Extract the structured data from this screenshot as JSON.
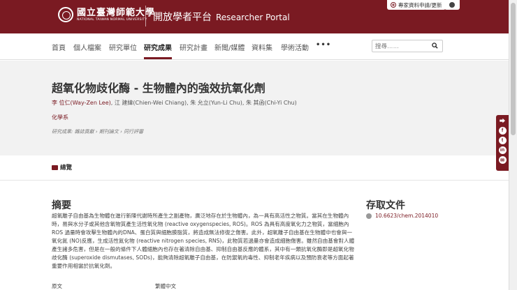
{
  "header": {
    "logo_zh": "國立臺灣師範大學",
    "logo_en": "NATIONAL TAIWAN NORMAL UNIVERSITY",
    "portal_zh": "開放學者平台",
    "portal_en": "Researcher Portal",
    "update_label": "專家資料申請/更新",
    "brand_color": "#7a1a22"
  },
  "nav": {
    "items": [
      {
        "label": "首頁"
      },
      {
        "label": "個人檔案"
      },
      {
        "label": "研究單位"
      },
      {
        "label": "研究成果"
      },
      {
        "label": "研究計畫"
      },
      {
        "label": "新聞/媒體"
      },
      {
        "label": "資料集"
      },
      {
        "label": "學術活動"
      }
    ],
    "active": "研究成果",
    "more": "•••",
    "search_placeholder": "搜尋……"
  },
  "publication": {
    "title": "超氧化物歧化酶 - 生物體內的強效抗氧化劑",
    "lead_author": "李 位仁(Way-Zen Lee)",
    "other_authors": ", 江 建緯(Chien-Wei Chiang), 朱 允立(Yun-Li Chu), 朱 其函(Chi-Yi Chu)",
    "department": "化學系",
    "output_type": "研究成果: 雜誌貢獻 › 期刊論文 › 同行評審"
  },
  "tabs": {
    "overview": "總覽"
  },
  "abstract": {
    "heading": "摘要",
    "body": "超氧離子自由基為生物體在進行新陳代謝時所產生之副產物，廣泛地存在於生物體內，為一具有高活性之物質。當其在生物體內時，易與水分子或其他含氧物質產生活性氧化物 (reactive oxygenspecies, ROS)。ROS 為具有高度氧化力之物質，當細胞內ROS 過量時會攻擊生物體內的DNA、蛋白質與細胞膜脂質，將造成無法修復之傷害。此外，超氧離子自由基在生物體中也會與一氧化氮 (NO)反應，生成活性氮化物 (reactive nitrogen species, RNS)，此物質若過量亦會造成細胞傷害。雖然自由基會對人體產生諸多危害，但是在一般的條件下人體細胞內也存在著清除自由基、抑制自由基反應的體系，其中有一類抗氧化酶即是超氧化物歧化酶 (superoxide dismutases, SODs)，能夠清除超氧離子自由基，在防禦氧的毒性、抑制老年疾病以及預防衰老等方面起著重要作用相當於抗氧化劑。"
  },
  "metadata": {
    "language_label": "原文",
    "language_value": "繁體中文"
  },
  "access": {
    "heading": "存取文件",
    "doi": "10.6623/chem.2014010"
  },
  "share": {
    "icons": [
      "share-icon",
      "facebook-icon",
      "twitter-icon",
      "linkedin-icon",
      "email-icon"
    ]
  }
}
